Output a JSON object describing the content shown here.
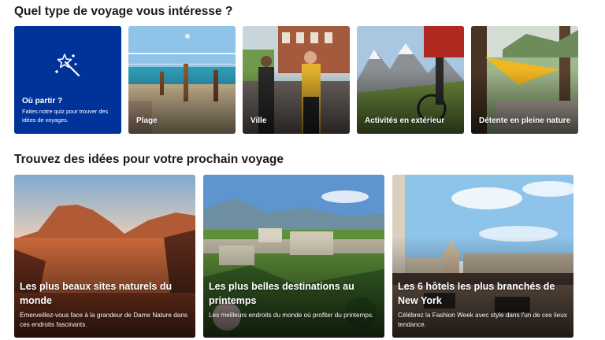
{
  "section1": {
    "title": "Quel type de voyage vous intéresse ?",
    "quiz_card": {
      "title": "Où partir ?",
      "description": "Faites notre quiz pour trouver des idées de voyages.",
      "icon": "magic-wand-icon"
    },
    "categories": [
      {
        "label": "Plage"
      },
      {
        "label": "Ville"
      },
      {
        "label": "Activités en extérieur"
      },
      {
        "label": "Détente en pleine nature"
      }
    ]
  },
  "section2": {
    "title": "Trouvez des idées pour votre prochain voyage",
    "cards": [
      {
        "title": "Les plus beaux sites naturels du monde",
        "description": "Émerveillez-vous face à la grandeur de Dame Nature dans ces endroits fascinants."
      },
      {
        "title": "Les plus belles destinations au printemps",
        "description": "Les meilleurs endroits du monde où profiter du printemps."
      },
      {
        "title": "Les 6 hôtels les plus branchés de New York",
        "description": "Célébrez la Fashion Week avec style dans l'un de ces lieux tendance."
      }
    ]
  },
  "colors": {
    "quiz_bg": "#003399",
    "text": "#1a1a1a"
  }
}
